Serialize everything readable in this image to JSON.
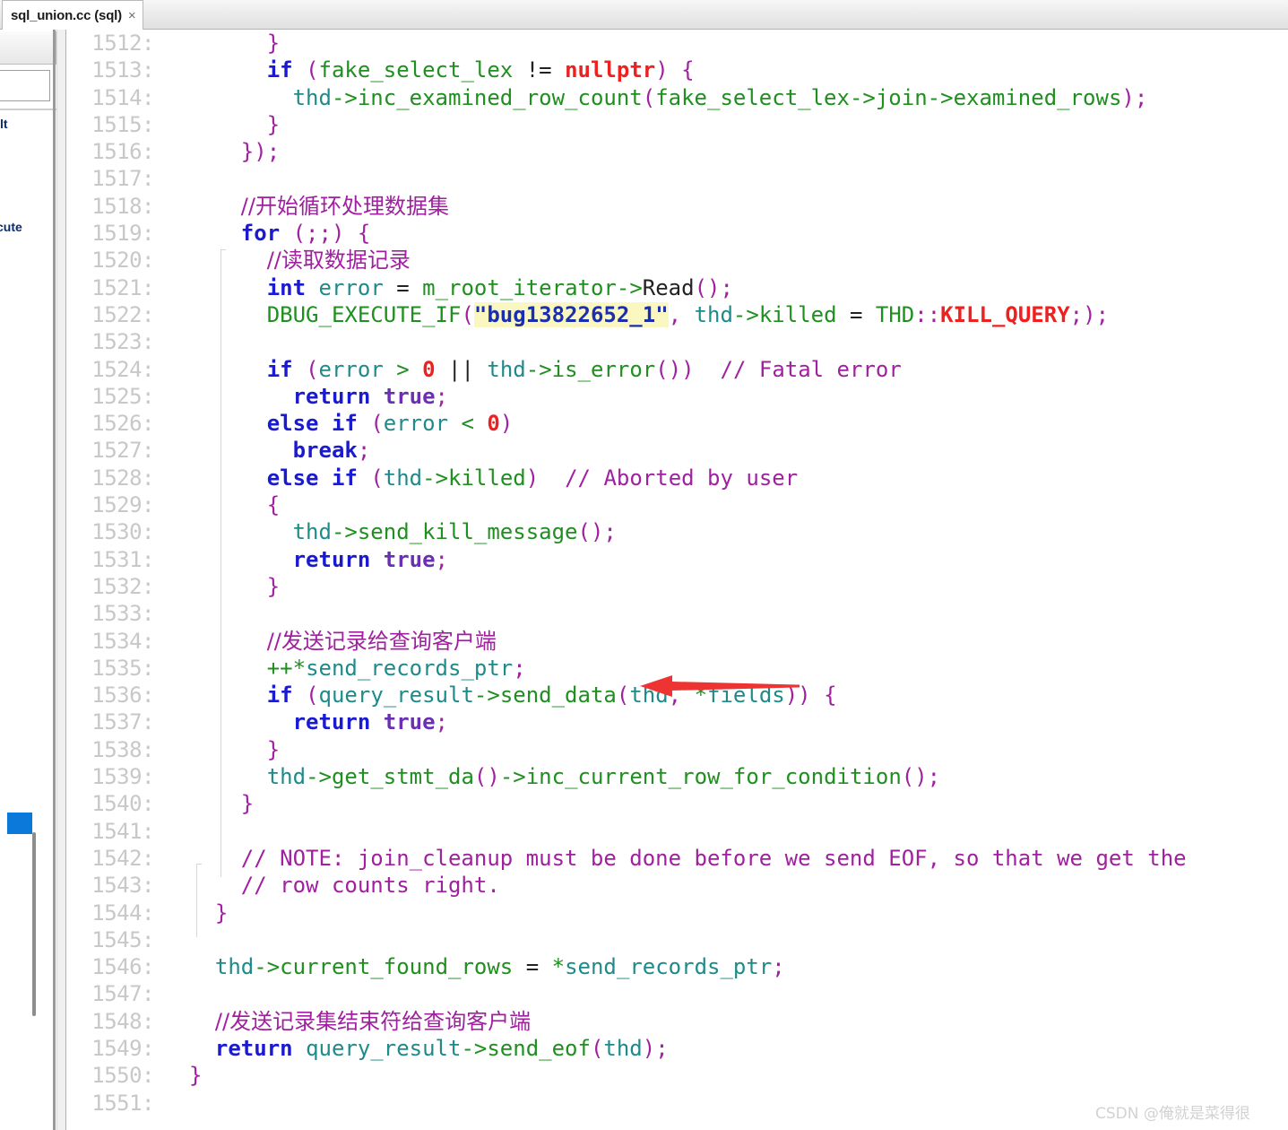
{
  "window": {
    "tab": {
      "label": "sql_union.cc (sql)",
      "close_glyph": "×"
    }
  },
  "left_panel": {
    "fragment_top": "lt",
    "fragment_bottom": "cute",
    "marker_color": "#0b79d9"
  },
  "watermark": "CSDN @俺就是菜得很",
  "editor": {
    "font_size_px": 24,
    "line_height_px": 30.3,
    "colors": {
      "line_number": "#c8c8c8",
      "keyword": "#1a1ad0",
      "keyword_secondary": "#6a2fb5",
      "identifier": "#1f8a8a",
      "function": "#1f8f1f",
      "punctuation": "#a020a0",
      "number": "#ee2020",
      "comment": "#a020a0",
      "string": "#1a2fb0",
      "search_highlight": "#fbf7c0",
      "background": "#ffffff",
      "annotation_arrow": "#ee3333"
    },
    "first_line": 1512,
    "last_line": 1551,
    "lines": [
      {
        "n": "1512:",
        "tokens": [
          {
            "t": "      ",
            "c": "plain"
          },
          {
            "t": "}",
            "c": "punc"
          }
        ]
      },
      {
        "n": "1513:",
        "tokens": [
          {
            "t": "      ",
            "c": "plain"
          },
          {
            "t": "if",
            "c": "kw"
          },
          {
            "t": " ",
            "c": "plain"
          },
          {
            "t": "(",
            "c": "punc"
          },
          {
            "t": "fake_select_lex",
            "c": "fn"
          },
          {
            "t": " ",
            "c": "plain"
          },
          {
            "t": "!=",
            "c": "plain"
          },
          {
            "t": " ",
            "c": "plain"
          },
          {
            "t": "nullptr",
            "c": "const"
          },
          {
            "t": ")",
            "c": "punc"
          },
          {
            "t": " ",
            "c": "plain"
          },
          {
            "t": "{",
            "c": "punc"
          }
        ]
      },
      {
        "n": "1514:",
        "tokens": [
          {
            "t": "        ",
            "c": "plain"
          },
          {
            "t": "thd",
            "c": "id"
          },
          {
            "t": "->",
            "c": "fn"
          },
          {
            "t": "inc_examined_row_count",
            "c": "fn"
          },
          {
            "t": "(",
            "c": "punc"
          },
          {
            "t": "fake_select_lex",
            "c": "fn"
          },
          {
            "t": "->",
            "c": "fn"
          },
          {
            "t": "join",
            "c": "fn"
          },
          {
            "t": "->",
            "c": "fn"
          },
          {
            "t": "examined_rows",
            "c": "fn"
          },
          {
            "t": ")",
            "c": "punc"
          },
          {
            "t": ";",
            "c": "punc"
          }
        ]
      },
      {
        "n": "1515:",
        "tokens": [
          {
            "t": "      ",
            "c": "plain"
          },
          {
            "t": "}",
            "c": "punc"
          }
        ]
      },
      {
        "n": "1516:",
        "tokens": [
          {
            "t": "    ",
            "c": "plain"
          },
          {
            "t": "})",
            "c": "punc"
          },
          {
            "t": ";",
            "c": "punc"
          }
        ]
      },
      {
        "n": "1517:",
        "tokens": []
      },
      {
        "n": "1518:",
        "tokens": [
          {
            "t": "    ",
            "c": "plain"
          },
          {
            "t": "//开始循环处理数据集",
            "c": "cmt cjk"
          }
        ]
      },
      {
        "n": "1519:",
        "tokens": [
          {
            "t": "    ",
            "c": "plain"
          },
          {
            "t": "for",
            "c": "kw"
          },
          {
            "t": " ",
            "c": "plain"
          },
          {
            "t": "(;;)",
            "c": "punc"
          },
          {
            "t": " ",
            "c": "plain"
          },
          {
            "t": "{",
            "c": "punc"
          }
        ]
      },
      {
        "n": "1520:",
        "tokens": [
          {
            "t": "      ",
            "c": "plain"
          },
          {
            "t": "//读取数据记录",
            "c": "cmt cjk"
          }
        ]
      },
      {
        "n": "1521:",
        "tokens": [
          {
            "t": "      ",
            "c": "plain"
          },
          {
            "t": "int",
            "c": "kw"
          },
          {
            "t": " ",
            "c": "plain"
          },
          {
            "t": "error",
            "c": "id"
          },
          {
            "t": " ",
            "c": "plain"
          },
          {
            "t": "=",
            "c": "plain"
          },
          {
            "t": " ",
            "c": "plain"
          },
          {
            "t": "m_root_iterator",
            "c": "fn"
          },
          {
            "t": "->",
            "c": "fn"
          },
          {
            "t": "Read",
            "c": "plain"
          },
          {
            "t": "()",
            "c": "punc"
          },
          {
            "t": ";",
            "c": "punc"
          }
        ]
      },
      {
        "n": "1522:",
        "tokens": [
          {
            "t": "      ",
            "c": "plain"
          },
          {
            "t": "DBUG_EXECUTE_IF",
            "c": "fn"
          },
          {
            "t": "(",
            "c": "punc"
          },
          {
            "t": "\"bug13822652_1\"",
            "c": "hl"
          },
          {
            "t": ",",
            "c": "punc"
          },
          {
            "t": " ",
            "c": "plain"
          },
          {
            "t": "thd",
            "c": "id"
          },
          {
            "t": "->",
            "c": "fn"
          },
          {
            "t": "killed",
            "c": "fn"
          },
          {
            "t": " ",
            "c": "plain"
          },
          {
            "t": "=",
            "c": "plain"
          },
          {
            "t": " ",
            "c": "plain"
          },
          {
            "t": "THD",
            "c": "fn"
          },
          {
            "t": "::",
            "c": "punc"
          },
          {
            "t": "KILL_QUERY",
            "c": "num"
          },
          {
            "t": ";)",
            "c": "punc"
          },
          {
            "t": ";",
            "c": "punc"
          }
        ]
      },
      {
        "n": "1523:",
        "tokens": []
      },
      {
        "n": "1524:",
        "tokens": [
          {
            "t": "      ",
            "c": "plain"
          },
          {
            "t": "if",
            "c": "kw"
          },
          {
            "t": " ",
            "c": "plain"
          },
          {
            "t": "(",
            "c": "punc"
          },
          {
            "t": "error",
            "c": "id"
          },
          {
            "t": " ",
            "c": "plain"
          },
          {
            "t": ">",
            "c": "fn"
          },
          {
            "t": " ",
            "c": "plain"
          },
          {
            "t": "0",
            "c": "num"
          },
          {
            "t": " ",
            "c": "plain"
          },
          {
            "t": "||",
            "c": "plain"
          },
          {
            "t": " ",
            "c": "plain"
          },
          {
            "t": "thd",
            "c": "id"
          },
          {
            "t": "->",
            "c": "fn"
          },
          {
            "t": "is_error",
            "c": "fn"
          },
          {
            "t": "())",
            "c": "punc"
          },
          {
            "t": "  ",
            "c": "plain"
          },
          {
            "t": "// Fatal error",
            "c": "cmt"
          }
        ]
      },
      {
        "n": "1525:",
        "tokens": [
          {
            "t": "        ",
            "c": "plain"
          },
          {
            "t": "return",
            "c": "kw"
          },
          {
            "t": " ",
            "c": "plain"
          },
          {
            "t": "true",
            "c": "kw2"
          },
          {
            "t": ";",
            "c": "punc"
          }
        ]
      },
      {
        "n": "1526:",
        "tokens": [
          {
            "t": "      ",
            "c": "plain"
          },
          {
            "t": "else",
            "c": "kw"
          },
          {
            "t": " ",
            "c": "plain"
          },
          {
            "t": "if",
            "c": "kw"
          },
          {
            "t": " ",
            "c": "plain"
          },
          {
            "t": "(",
            "c": "punc"
          },
          {
            "t": "error",
            "c": "id"
          },
          {
            "t": " ",
            "c": "plain"
          },
          {
            "t": "<",
            "c": "fn"
          },
          {
            "t": " ",
            "c": "plain"
          },
          {
            "t": "0",
            "c": "num"
          },
          {
            "t": ")",
            "c": "punc"
          }
        ]
      },
      {
        "n": "1527:",
        "tokens": [
          {
            "t": "        ",
            "c": "plain"
          },
          {
            "t": "break",
            "c": "kw"
          },
          {
            "t": ";",
            "c": "punc"
          }
        ]
      },
      {
        "n": "1528:",
        "tokens": [
          {
            "t": "      ",
            "c": "plain"
          },
          {
            "t": "else",
            "c": "kw"
          },
          {
            "t": " ",
            "c": "plain"
          },
          {
            "t": "if",
            "c": "kw"
          },
          {
            "t": " ",
            "c": "plain"
          },
          {
            "t": "(",
            "c": "punc"
          },
          {
            "t": "thd",
            "c": "id"
          },
          {
            "t": "->",
            "c": "fn"
          },
          {
            "t": "killed",
            "c": "fn"
          },
          {
            "t": ")",
            "c": "punc"
          },
          {
            "t": "  ",
            "c": "plain"
          },
          {
            "t": "// Aborted by user",
            "c": "cmt"
          }
        ]
      },
      {
        "n": "1529:",
        "tokens": [
          {
            "t": "      ",
            "c": "plain"
          },
          {
            "t": "{",
            "c": "punc"
          }
        ]
      },
      {
        "n": "1530:",
        "tokens": [
          {
            "t": "        ",
            "c": "plain"
          },
          {
            "t": "thd",
            "c": "id"
          },
          {
            "t": "->",
            "c": "fn"
          },
          {
            "t": "send_kill_message",
            "c": "fn"
          },
          {
            "t": "()",
            "c": "punc"
          },
          {
            "t": ";",
            "c": "punc"
          }
        ]
      },
      {
        "n": "1531:",
        "tokens": [
          {
            "t": "        ",
            "c": "plain"
          },
          {
            "t": "return",
            "c": "kw"
          },
          {
            "t": " ",
            "c": "plain"
          },
          {
            "t": "true",
            "c": "kw2"
          },
          {
            "t": ";",
            "c": "punc"
          }
        ]
      },
      {
        "n": "1532:",
        "tokens": [
          {
            "t": "      ",
            "c": "plain"
          },
          {
            "t": "}",
            "c": "punc"
          }
        ]
      },
      {
        "n": "1533:",
        "tokens": []
      },
      {
        "n": "1534:",
        "tokens": [
          {
            "t": "      ",
            "c": "plain"
          },
          {
            "t": "//发送记录给查询客户端",
            "c": "cmt cjk"
          }
        ]
      },
      {
        "n": "1535:",
        "tokens": [
          {
            "t": "      ",
            "c": "plain"
          },
          {
            "t": "++*",
            "c": "fn"
          },
          {
            "t": "send_records_ptr",
            "c": "id"
          },
          {
            "t": ";",
            "c": "punc"
          }
        ]
      },
      {
        "n": "1536:",
        "tokens": [
          {
            "t": "      ",
            "c": "plain"
          },
          {
            "t": "if",
            "c": "kw"
          },
          {
            "t": " ",
            "c": "plain"
          },
          {
            "t": "(",
            "c": "punc"
          },
          {
            "t": "query_result",
            "c": "id"
          },
          {
            "t": "->",
            "c": "fn"
          },
          {
            "t": "send_data",
            "c": "fn"
          },
          {
            "t": "(",
            "c": "punc"
          },
          {
            "t": "thd",
            "c": "id"
          },
          {
            "t": ",",
            "c": "punc"
          },
          {
            "t": " ",
            "c": "plain"
          },
          {
            "t": "*",
            "c": "fn"
          },
          {
            "t": "fields",
            "c": "id"
          },
          {
            "t": "))",
            "c": "punc"
          },
          {
            "t": " ",
            "c": "plain"
          },
          {
            "t": "{",
            "c": "punc"
          }
        ]
      },
      {
        "n": "1537:",
        "tokens": [
          {
            "t": "        ",
            "c": "plain"
          },
          {
            "t": "return",
            "c": "kw"
          },
          {
            "t": " ",
            "c": "plain"
          },
          {
            "t": "true",
            "c": "kw2"
          },
          {
            "t": ";",
            "c": "punc"
          }
        ]
      },
      {
        "n": "1538:",
        "tokens": [
          {
            "t": "      ",
            "c": "plain"
          },
          {
            "t": "}",
            "c": "punc"
          }
        ]
      },
      {
        "n": "1539:",
        "tokens": [
          {
            "t": "      ",
            "c": "plain"
          },
          {
            "t": "thd",
            "c": "id"
          },
          {
            "t": "->",
            "c": "fn"
          },
          {
            "t": "get_stmt_da",
            "c": "fn"
          },
          {
            "t": "()",
            "c": "punc"
          },
          {
            "t": "->",
            "c": "fn"
          },
          {
            "t": "inc_current_row_for_condition",
            "c": "fn"
          },
          {
            "t": "()",
            "c": "punc"
          },
          {
            "t": ";",
            "c": "punc"
          }
        ]
      },
      {
        "n": "1540:",
        "tokens": [
          {
            "t": "    ",
            "c": "plain"
          },
          {
            "t": "}",
            "c": "punc"
          }
        ]
      },
      {
        "n": "1541:",
        "tokens": []
      },
      {
        "n": "1542:",
        "tokens": [
          {
            "t": "    ",
            "c": "plain"
          },
          {
            "t": "// NOTE: join_cleanup must be done before we send EOF, so that we get the",
            "c": "cmt"
          }
        ]
      },
      {
        "n": "1543:",
        "tokens": [
          {
            "t": "    ",
            "c": "plain"
          },
          {
            "t": "// row counts right.",
            "c": "cmt"
          }
        ]
      },
      {
        "n": "1544:",
        "tokens": [
          {
            "t": "  ",
            "c": "plain"
          },
          {
            "t": "}",
            "c": "punc"
          }
        ]
      },
      {
        "n": "1545:",
        "tokens": []
      },
      {
        "n": "1546:",
        "tokens": [
          {
            "t": "  ",
            "c": "plain"
          },
          {
            "t": "thd",
            "c": "id"
          },
          {
            "t": "->",
            "c": "fn"
          },
          {
            "t": "current_found_rows",
            "c": "fn"
          },
          {
            "t": " ",
            "c": "plain"
          },
          {
            "t": "=",
            "c": "plain"
          },
          {
            "t": " ",
            "c": "plain"
          },
          {
            "t": "*",
            "c": "fn"
          },
          {
            "t": "send_records_ptr",
            "c": "id"
          },
          {
            "t": ";",
            "c": "punc"
          }
        ]
      },
      {
        "n": "1547:",
        "tokens": []
      },
      {
        "n": "1548:",
        "tokens": [
          {
            "t": "  ",
            "c": "plain"
          },
          {
            "t": "//发送记录集结束符给查询客户端",
            "c": "cmt cjk"
          }
        ]
      },
      {
        "n": "1549:",
        "tokens": [
          {
            "t": "  ",
            "c": "plain"
          },
          {
            "t": "return",
            "c": "kw"
          },
          {
            "t": " ",
            "c": "plain"
          },
          {
            "t": "query_result",
            "c": "id"
          },
          {
            "t": "->",
            "c": "fn"
          },
          {
            "t": "send_eof",
            "c": "fn"
          },
          {
            "t": "(",
            "c": "punc"
          },
          {
            "t": "thd",
            "c": "id"
          },
          {
            "t": ")",
            "c": "punc"
          },
          {
            "t": ";",
            "c": "punc"
          }
        ]
      },
      {
        "n": "1550:",
        "tokens": [
          {
            "t": "",
            "c": "plain"
          },
          {
            "t": "}",
            "c": "punc"
          }
        ]
      },
      {
        "n": "1551:",
        "tokens": []
      }
    ]
  },
  "annotation": {
    "type": "arrow",
    "direction": "left",
    "color": "#ee3333",
    "points_at_line": "1534:"
  }
}
